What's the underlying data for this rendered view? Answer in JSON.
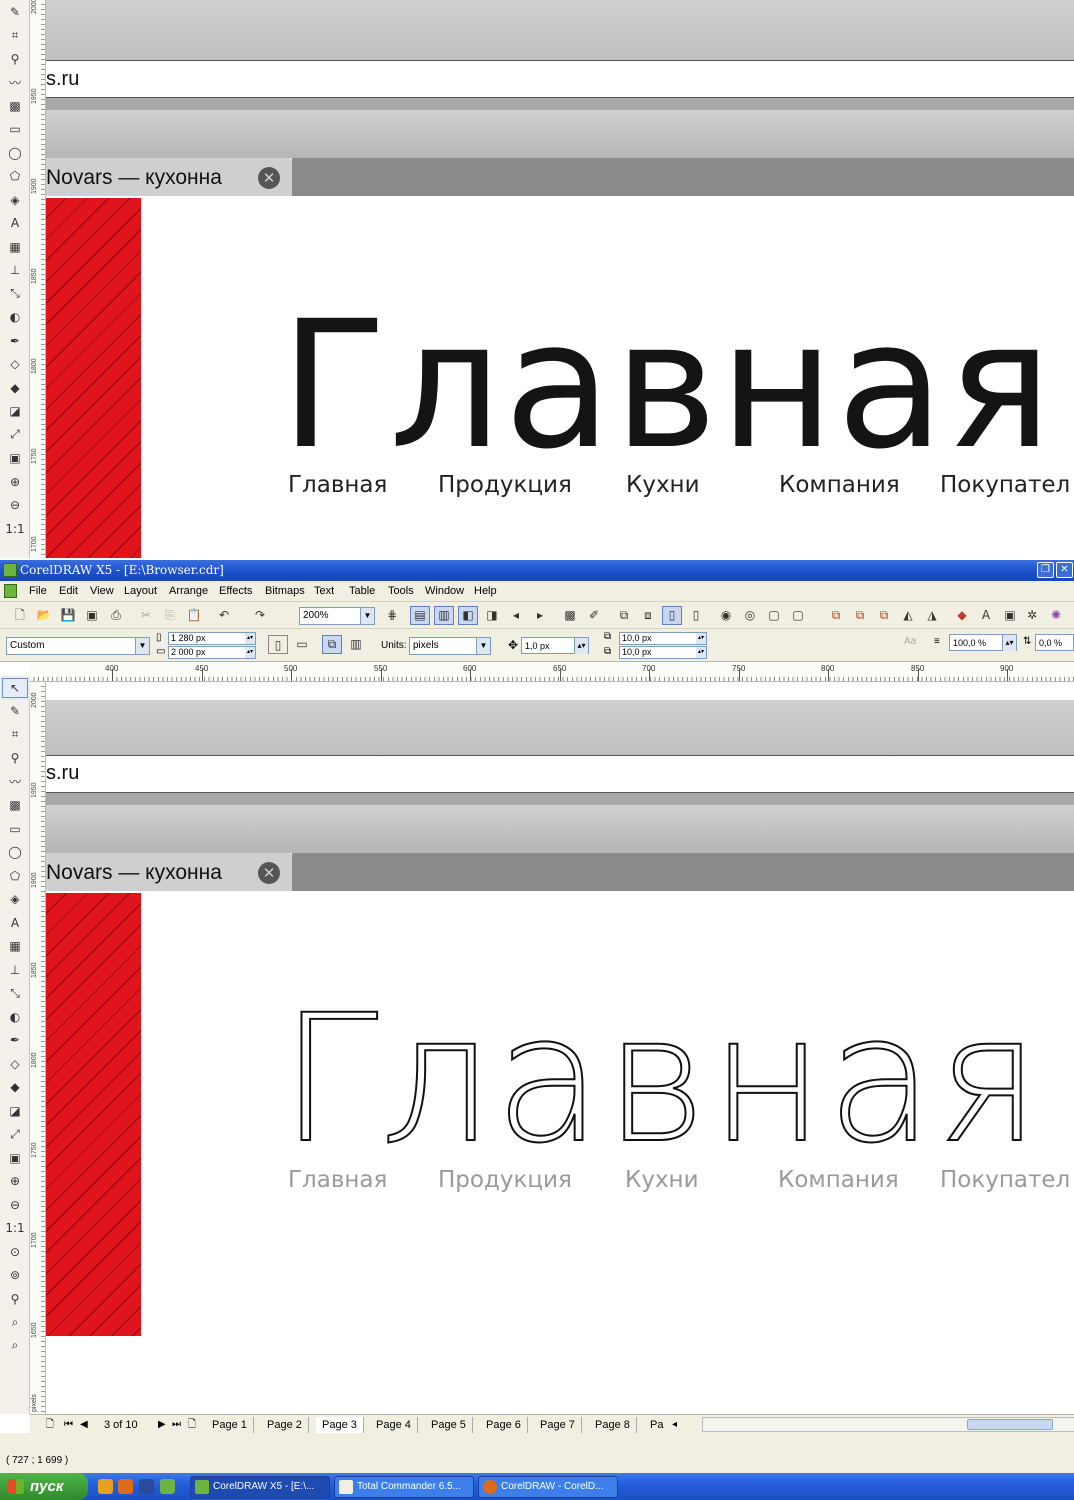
{
  "canvas": {
    "url_fragment": "s.ru",
    "tab_title": "Novars — кухонна",
    "tab_close": "✕",
    "headline": "Главная",
    "nav_items": [
      "Главная",
      "Продукция",
      "Кухни",
      "Компания",
      "Покупател"
    ]
  },
  "vruler_upper": [
    "2000",
    "1950",
    "1900",
    "1850",
    "1800",
    "1750",
    "1700"
  ],
  "vruler_lower": [
    "2000",
    "1950",
    "1900",
    "1850",
    "1800",
    "1750",
    "1700",
    "1650",
    "pixels"
  ],
  "window": {
    "title": "CorelDRAW X5 - [E:\\Browser.cdr]"
  },
  "menubar": [
    "File",
    "Edit",
    "View",
    "Layout",
    "Arrange",
    "Effects",
    "Bitmaps",
    "Text",
    "Table",
    "Tools",
    "Window",
    "Help"
  ],
  "standard_toolbar": {
    "zoom": "200%"
  },
  "property_bar": {
    "page_preset": "Custom",
    "width": "1 280 px",
    "height": "2 000 px",
    "units_label": "Units:",
    "units_value": "pixels",
    "nudge": "1,0 px",
    "dup_x": "10,0 px",
    "dup_y": "10,0 px",
    "scale": "100,0 %",
    "angle": "0,0 %"
  },
  "hruler": [
    "400",
    "450",
    "500",
    "550",
    "600",
    "650",
    "700",
    "750",
    "800",
    "850",
    "900"
  ],
  "page_nav": {
    "counter": "3 of 10",
    "pages": [
      "Page 1",
      "Page 2",
      "Page 3",
      "Page 4",
      "Page 5",
      "Page 6",
      "Page 7",
      "Page 8",
      "Pa"
    ],
    "current": "Page 3"
  },
  "status": {
    "coords": "( 727  ; 1 699  )"
  },
  "taskbar": {
    "start_label": "пуск",
    "tasks": [
      "CorelDRAW X5 - [E:\\...",
      "Total Commander 6.5...",
      "CorelDRAW - CorelD..."
    ]
  },
  "colors": {
    "accent_red": "#e0141c",
    "titlebar_blue": "#1a4fc9",
    "start_green": "#2f8a2a"
  }
}
